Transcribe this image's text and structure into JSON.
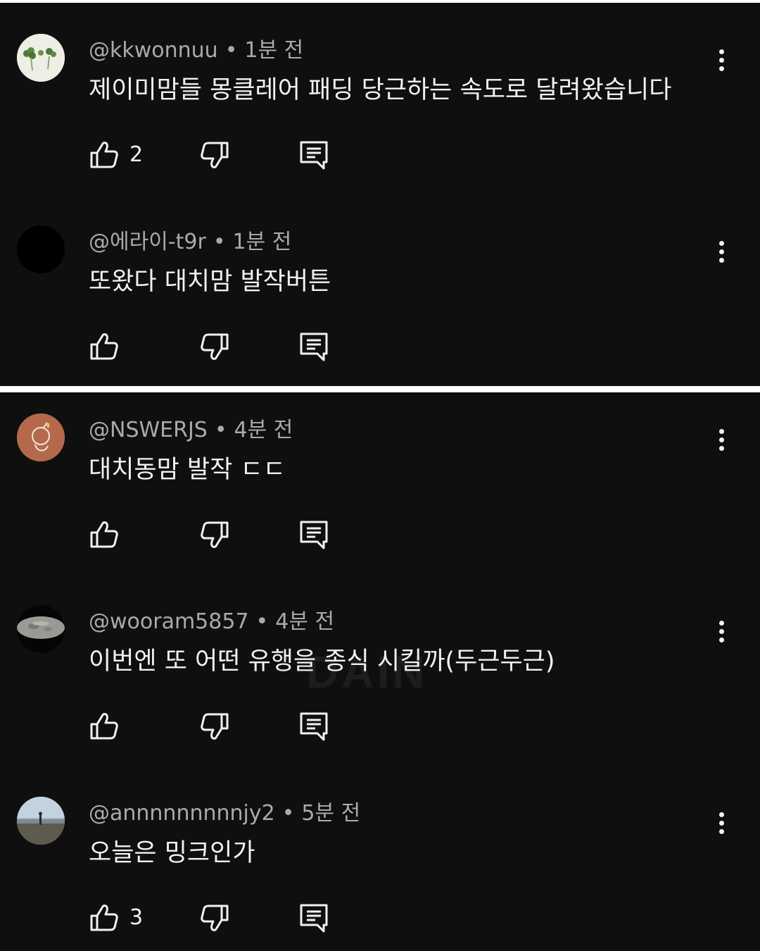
{
  "panels": [
    {
      "comments": [
        {
          "handle": "@kkwonnuu",
          "time": "1분 전",
          "text": "제이미맘들 몽클레어 패딩 당근하는 속도로 달려왔습니다",
          "likes": "2",
          "avatar": "clover-avatar"
        },
        {
          "handle": "@에라이-t9r",
          "time": "1분 전",
          "text": "또왔다 대치맘 발작버튼",
          "likes": "",
          "avatar": "black-avatar"
        }
      ]
    },
    {
      "comments": [
        {
          "handle": "@NSWERJS",
          "time": "4분 전",
          "text": "대치동맘 발작 ㄷㄷ",
          "likes": "",
          "avatar": "drawing-avatar"
        },
        {
          "handle": "@wooram5857",
          "time": "4분 전",
          "text": "이번엔 또 어떤 유행을 종식 시킬까(두근두근)",
          "likes": "",
          "avatar": "moon-avatar"
        },
        {
          "handle": "@annnnnnnnnjy2",
          "time": "5분 전",
          "text": "오늘은 밍크인가",
          "likes": "3",
          "avatar": "landscape-avatar"
        }
      ]
    }
  ],
  "separator": "•",
  "watermark": "DAIN",
  "icons": {
    "like": "thumbs-up-icon",
    "dislike": "thumbs-down-icon",
    "reply": "comment-reply-icon",
    "more": "more-vertical-icon"
  },
  "colors": {
    "background": "#0f0f0f",
    "text": "#f1f1f1",
    "meta": "#aaaaaa",
    "divider": "#ffffff"
  }
}
